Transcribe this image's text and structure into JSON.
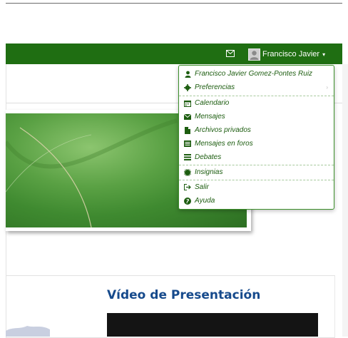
{
  "navbar": {
    "mail_icon": "envelope-outline-icon",
    "user_name": "Francisco Javier",
    "user_caret": "▾",
    "avatar_icon": "user-avatar-icon"
  },
  "user_menu": {
    "items": [
      {
        "icon": "user-icon",
        "label": "Francisco Javier Gomez-Pontes Ruiz"
      },
      {
        "icon": "cog-icon",
        "label": "Preferencias",
        "submenu_arrow": "›"
      },
      {
        "icon": "calendar-icon",
        "label": "Calendario"
      },
      {
        "icon": "envelope-icon",
        "label": "Mensajes"
      },
      {
        "icon": "file-icon",
        "label": "Archivos privados"
      },
      {
        "icon": "list-alt-icon",
        "label": "Mensajes en foros"
      },
      {
        "icon": "list-icon",
        "label": "Debates"
      },
      {
        "icon": "certificate-icon",
        "label": "Insignias"
      },
      {
        "icon": "sign-out-icon",
        "label": "Salir"
      },
      {
        "icon": "question-circle-icon",
        "label": "Ayuda"
      }
    ]
  },
  "main": {
    "video_title": "Vídeo de Presentación"
  },
  "colors": {
    "navbar": "#1f6e12",
    "menu_text": "#1d5d10",
    "title": "#164a8c"
  }
}
